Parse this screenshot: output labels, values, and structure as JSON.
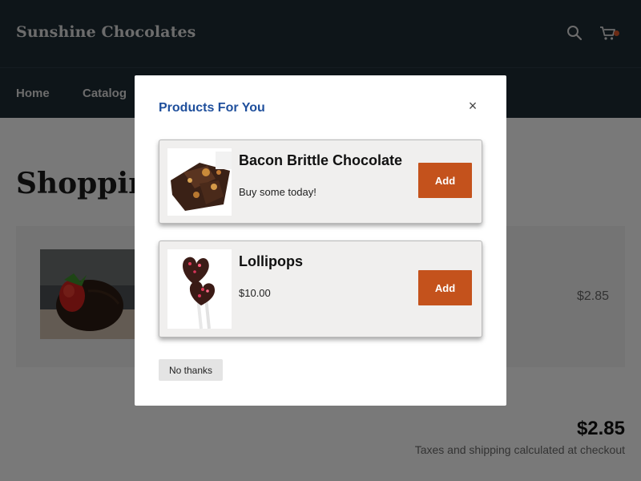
{
  "header": {
    "brand": "Sunshine Chocolates",
    "icons": [
      "search-icon",
      "cart-icon"
    ],
    "cart_badge_color": "#d6572a"
  },
  "nav": {
    "items": [
      "Home",
      "Catalog"
    ]
  },
  "page": {
    "title": "Shopping",
    "cart_item": {
      "price": "$2.85"
    },
    "subtotal": "$2.85",
    "tax_note": "Taxes and shipping calculated at checkout"
  },
  "modal": {
    "title": "Products For You",
    "close_icon": "close-icon",
    "products": [
      {
        "name": "Bacon Brittle Chocolate",
        "subtitle": "Buy some today!",
        "add_label": "Add"
      },
      {
        "name": "Lollipops",
        "subtitle": "$10.00",
        "add_label": "Add"
      }
    ],
    "decline_label": "No thanks"
  },
  "colors": {
    "header_bg": "#1d2a33",
    "accent_button": "#c4521c",
    "modal_title": "#1f4f9c"
  }
}
